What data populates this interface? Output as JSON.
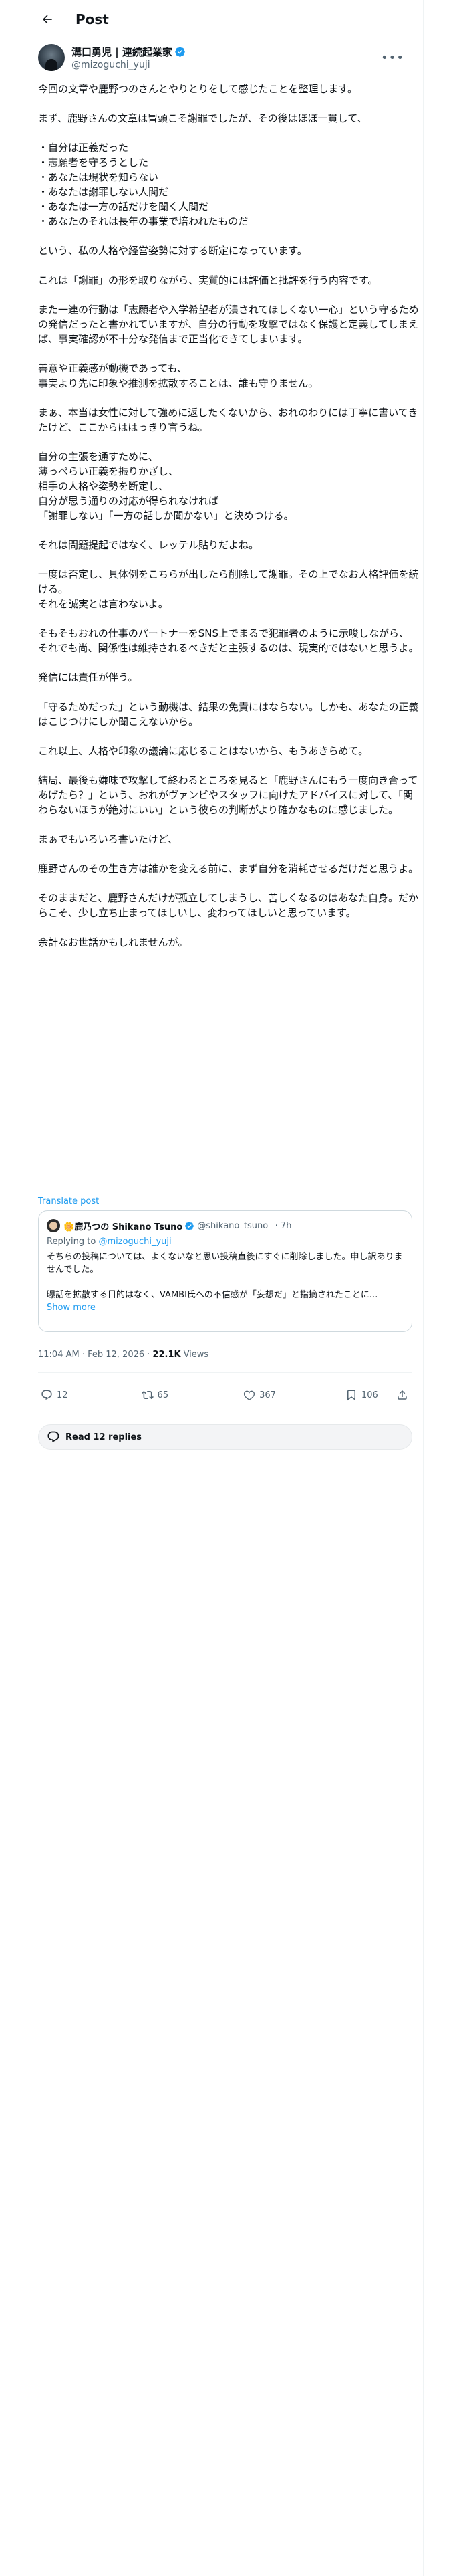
{
  "header": {
    "title": "Post"
  },
  "author": {
    "name": "溝口勇児 | 連続起業家",
    "handle": "@mizoguchi_yuji"
  },
  "post": {
    "paragraphs": [
      "今回の文章や鹿野つのさんとやりとりをして感じたことを整理します。",
      "まず、鹿野さんの文章は冒頭こそ謝罪でしたが、その後はほぼ一貫して、",
      "・自分は正義だった\n・志願者を守ろうとした\n・あなたは現状を知らない\n・あなたは謝罪しない人間だ\n・あなたは一方の話だけを聞く人間だ\n・あなたのそれは長年の事業で培われたものだ",
      "という、私の人格や経営姿勢に対する断定になっています。",
      "これは「謝罪」の形を取りながら、実質的には評価と批評を行う内容です。",
      "また一連の行動は「志願者や入学希望者が潰されてほしくない一心」という守るための発信だったと書かれていますが、自分の行動を攻撃ではなく保護と定義してしまえば、事実確認が不十分な発信まで正当化できてしまいます。",
      "善意や正義感が動機であっても、\n事実より先に印象や推測を拡散することは、誰も守りません。",
      "まぁ、本当は女性に対して強めに返したくないから、おれのわりには丁寧に書いてきたけど、ここからははっきり言うね。",
      "自分の主張を通すために、\n薄っぺらい正義を振りかざし、\n相手の人格や姿勢を断定し、\n自分が思う通りの対応が得られなければ\n「謝罪しない」「一方の話しか聞かない」と決めつける。",
      "それは問題提起ではなく、レッテル貼りだよね。",
      "一度は否定し、具体例をこちらが出したら削除して謝罪。その上でなお人格評価を続ける。\nそれを誠実とは言わないよ。",
      "そもそもおれの仕事のパートナーをSNS上でまるで犯罪者のように示唆しながら、\nそれでも尚、関係性は維持されるべきだと主張するのは、現実的ではないと思うよ。",
      "発信には責任が伴う。",
      "「守るためだった」という動機は、結果の免責にはならない。しかも、あなたの正義はこじつけにしか聞こえないから。",
      "これ以上、人格や印象の議論に応じることはないから、もうあきらめて。",
      "結局、最後も嫌味で攻撃して終わるところを見ると「鹿野さんにもう一度向き合ってあげたら？」という、おれがヴァンビやスタッフに向けたアドバイスに対して、「関わらないほうが絶対にいい」という彼らの判断がより確かなものに感じました。",
      "まぁでもいろいろ書いたけど、",
      "鹿野さんのその生き方は誰かを変える前に、まず自分を消耗させるだけだと思うよ。",
      "そのままだと、鹿野さんだけが孤立してしまうし、苦しくなるのはあなた自身。だからこそ、少し立ち止まってほしいし、変わってほしいと思っています。",
      "余計なお世話かもしれませんが。"
    ],
    "translate": "Translate post"
  },
  "quote": {
    "name": "鹿乃つの",
    "emoji_prefix": "🌼",
    "name_suffix": "Shikano Tsuno",
    "handle": "@shikano_tsuno_",
    "time": "· 7h",
    "reply_prefix": "Replying to ",
    "reply_handle": "@mizoguchi_yuji",
    "text1": "そちらの投稿については、よくないなと思い投稿直後にすぐに削除しました。申し訳ありませんでした。",
    "text2": "曝話を拡散する目的はなく、VAMBI氏への不信感が「妄想だ」と指摘されたことに...",
    "show_more": "Show more"
  },
  "meta": {
    "time": "11:04 AM · Feb 12, 2026 · ",
    "views_count": "22.1K",
    "views_label": "Views"
  },
  "actions": {
    "replies": "12",
    "reposts": "65",
    "likes": "367",
    "bookmarks": "106"
  },
  "read_replies": "Read 12 replies"
}
